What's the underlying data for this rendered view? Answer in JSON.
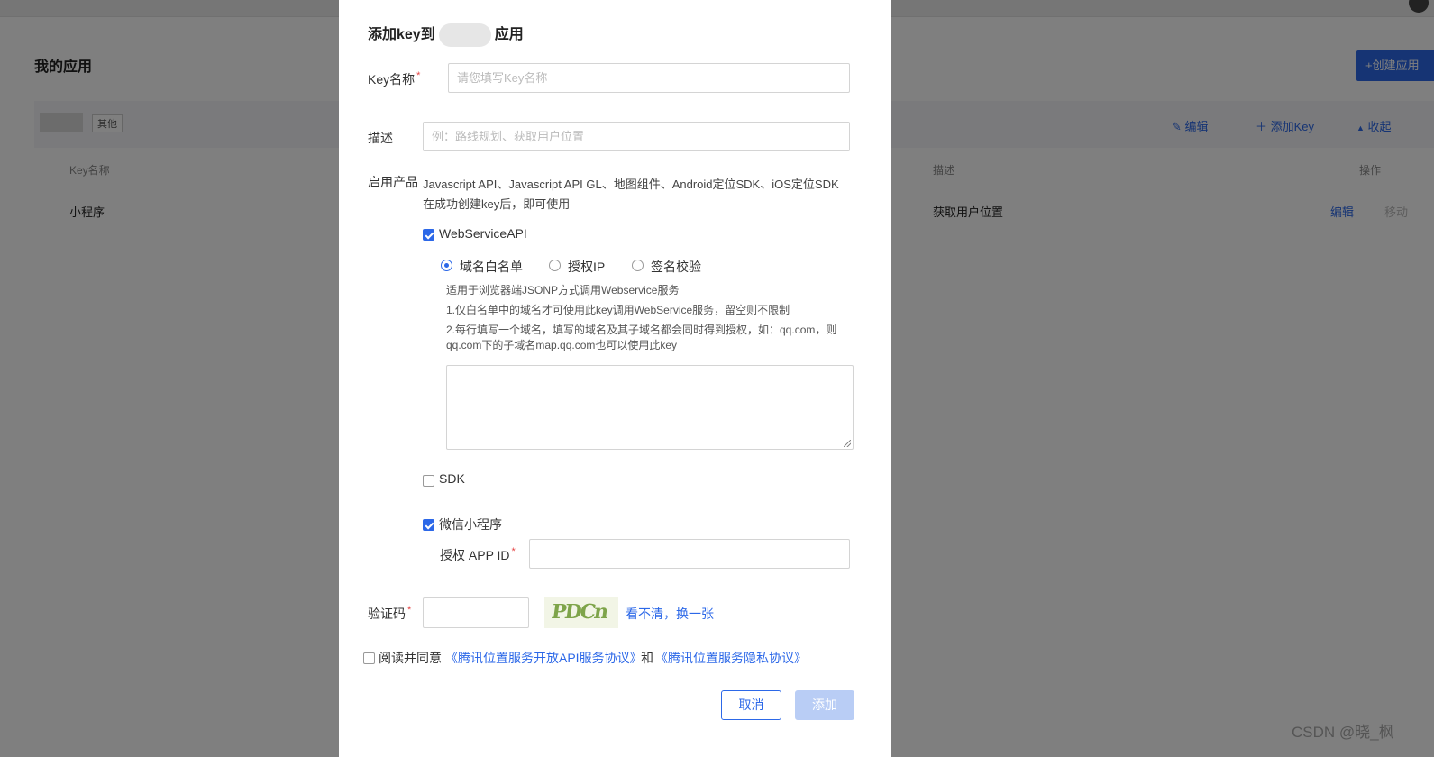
{
  "background": {
    "page_title": "我的应用",
    "create_app_label": "+创建应用",
    "app_tag": "其他",
    "actions": {
      "edit": "编辑",
      "add_key": "添加Key",
      "collapse": "收起"
    },
    "table": {
      "headers": {
        "key_name": "Key名称",
        "description": "描述",
        "operation": "操作"
      },
      "row": {
        "key_name": "小程序",
        "description": "获取用户位置",
        "edit": "编辑",
        "move": "移动"
      }
    }
  },
  "modal": {
    "title_prefix": "添加key到",
    "title_suffix": "应用",
    "key_name": {
      "label": "Key名称",
      "placeholder": "请您填写Key名称"
    },
    "description": {
      "label": "描述",
      "placeholder": "例：路线规划、获取用户位置"
    },
    "products": {
      "label": "启用产品",
      "desc": "Javascript API、Javascript API GL、地图组件、Android定位SDK、iOS定位SDK在成功创建key后，即可使用",
      "webservice": {
        "label": "WebServiceAPI",
        "checked": true,
        "options": [
          "域名白名单",
          "授权IP",
          "签名校验"
        ],
        "selected_index": 0,
        "hints": [
          "适用于浏览器端JSONP方式调用Webservice服务",
          "1.仅白名单中的域名才可使用此key调用WebService服务，留空则不限制",
          "2.每行填写一个域名，填写的域名及其子域名都会同时得到授权，如：qq.com，则qq.com下的子域名map.qq.com也可以使用此key"
        ]
      },
      "sdk": {
        "label": "SDK",
        "checked": false
      },
      "miniprogram": {
        "label": "微信小程序",
        "checked": true,
        "appid_label": "授权 APP ID"
      }
    },
    "captcha": {
      "label": "验证码",
      "image_text": "PDCn",
      "refresh_link": "看不清，换一张"
    },
    "agreement": {
      "prefix": "阅读并同意",
      "link1": "《腾讯位置服务开放API服务协议》",
      "and": "和",
      "link2": "《腾讯位置服务隐私协议》"
    },
    "buttons": {
      "cancel": "取消",
      "add": "添加"
    }
  },
  "watermark": "CSDN @晓_枫",
  "colors": {
    "primary": "#2c68e8",
    "required": "#e54545",
    "disabled_button": "#b9cdf5"
  }
}
